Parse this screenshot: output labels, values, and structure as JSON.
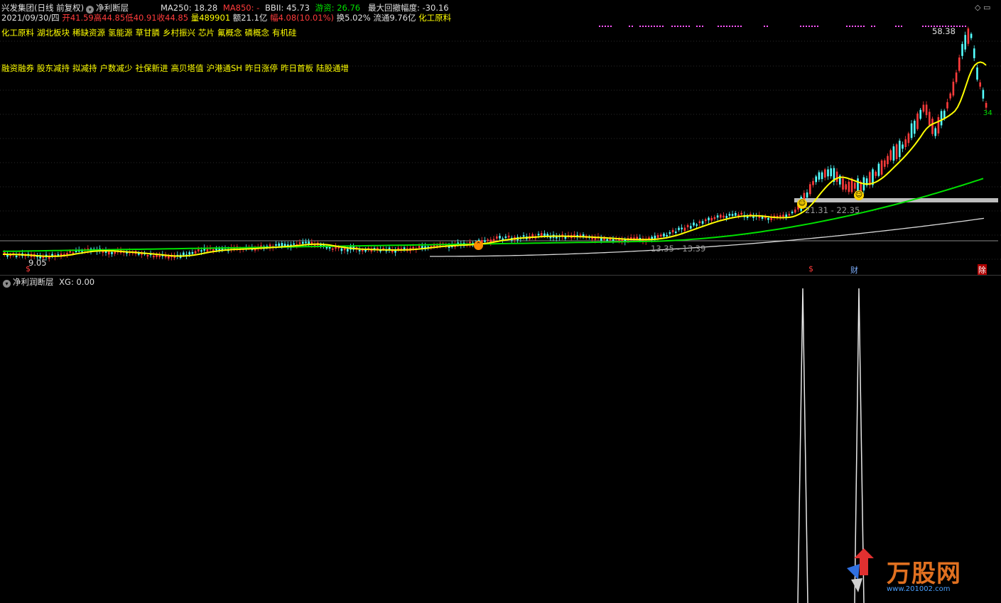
{
  "header": {
    "stock_name": "兴发集团",
    "period": "(日线 前复权)",
    "indicator": "净利断层",
    "ma250_label": "MA250: ",
    "ma250_value": "18.28",
    "ma850_label": "MA850: ",
    "ma850_value": "-",
    "bbii_label": "BBII: ",
    "bbii_value": "45.73",
    "youzi_label": "游资: ",
    "youzi_value": "26.76",
    "drawdown_label": "最大回撤幅度: ",
    "drawdown_value": "-30.16"
  },
  "quote": {
    "date": "2021/09/30/四",
    "open_label": "开",
    "open": "41.59",
    "high_label": "高",
    "high": "44.85",
    "low_label": "低",
    "low": "40.91",
    "close_label": "收",
    "close": "44.85",
    "vol_label": "量",
    "vol": "489901",
    "amt_label": "额",
    "amt": "21.1亿",
    "chg_label": "幅",
    "chg": "4.08(10.01%)",
    "turnover_label": "换",
    "turnover": "5.02%",
    "float_label": "流通",
    "float": "9.76亿",
    "industry": "化工原料"
  },
  "concepts_row1": [
    "化工原料",
    "湖北板块",
    "稀缺资源",
    "氢能源",
    "草甘膦",
    "乡村振兴",
    "芯片",
    "氟概念",
    "磷概念",
    "有机硅"
  ],
  "concepts_row2": [
    "融资融券",
    "股东减持",
    "拟减持",
    "户数减少",
    "社保新进",
    "高贝塔值",
    "沪港通SH",
    "昨日涨停",
    "昨日首板",
    "陆股通增"
  ],
  "chart_labels": {
    "peak": "58.38",
    "gap_upper": "21.31 - 22.35",
    "gap_lower": "13.35 - 13.39",
    "low_value": "9.05",
    "num_34": "34"
  },
  "markers": {
    "s1": "$",
    "s2": "$",
    "cai": "财",
    "jie": "除"
  },
  "sub_panel": {
    "title": "净利润断层",
    "xg_label": "XG: ",
    "xg_value": "0.00"
  },
  "watermark": {
    "brand": "万股网",
    "url": "www.201002.com"
  },
  "colors": {
    "bg": "#000000",
    "up": "#ff3b3b",
    "down": "#54ffff",
    "ma_yellow": "#ffff00",
    "ma_green": "#00e000",
    "ma_white": "#d8d8d8",
    "magenta": "#ff55ff"
  }
}
